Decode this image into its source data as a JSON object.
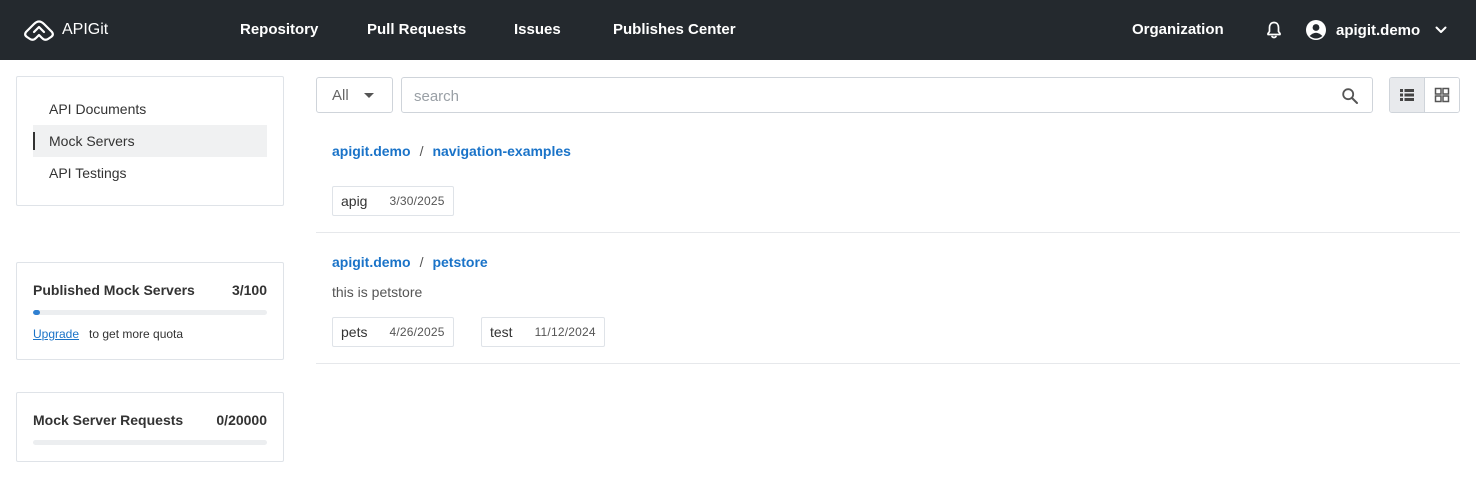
{
  "app": {
    "name": "APIGit"
  },
  "nav": {
    "items": [
      "Repository",
      "Pull Requests",
      "Issues",
      "Publishes Center"
    ],
    "organization": "Organization",
    "username": "apigit.demo"
  },
  "sidebar": {
    "items": [
      {
        "label": "API Documents",
        "active": false
      },
      {
        "label": "Mock Servers",
        "active": true
      },
      {
        "label": "API Testings",
        "active": false
      }
    ]
  },
  "quota": {
    "published": {
      "title": "Published Mock Servers",
      "count": "3/100",
      "fraction": 0.03,
      "upgrade": "Upgrade",
      "note": "to get more quota"
    },
    "requests": {
      "title": "Mock Server Requests",
      "count": "0/20000",
      "fraction": 0
    }
  },
  "toolbar": {
    "filter_value": "All",
    "search_placeholder": "search",
    "view_mode": "list"
  },
  "entries": [
    {
      "owner": "apigit.demo",
      "separator": "/",
      "name": "navigation-examples",
      "description": "",
      "tags": [
        {
          "name": "apig",
          "date": "3/30/2025"
        }
      ]
    },
    {
      "owner": "apigit.demo",
      "separator": "/",
      "name": "petstore",
      "description": "this is petstore",
      "tags": [
        {
          "name": "pets",
          "date": "4/26/2025"
        },
        {
          "name": "test",
          "date": "11/12/2024"
        }
      ]
    }
  ],
  "colors": {
    "topbar": "#24292e",
    "link": "#1a73c8",
    "progress": "#2f80d1"
  }
}
